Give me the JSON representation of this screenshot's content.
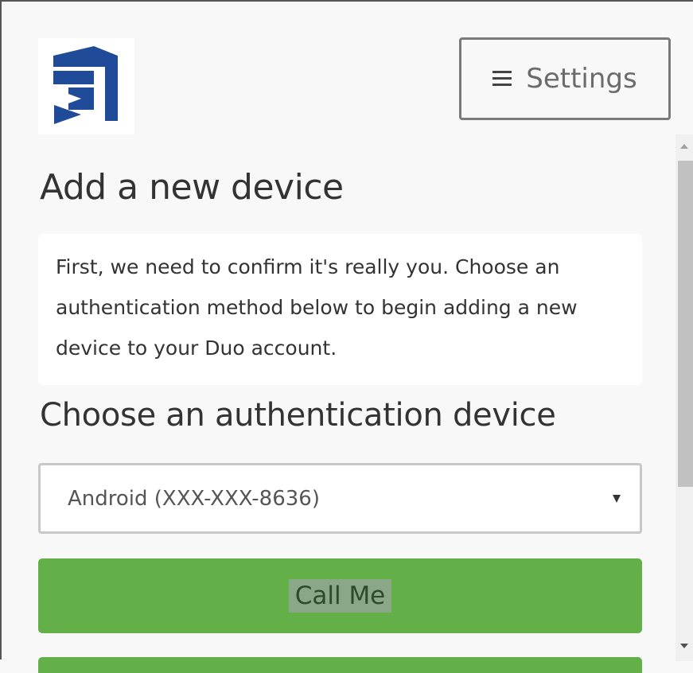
{
  "header": {
    "logo_name": "company-logo",
    "settings_label": "Settings"
  },
  "main": {
    "title": "Add a new device",
    "intro_text": "First, we need to confirm it's really you. Choose an authentication method below to begin adding a new device to your Duo account.",
    "device_heading": "Choose an authentication device",
    "device_select": {
      "selected": "Android (XXX-XXX-8636)"
    },
    "call_me_label": "Call Me"
  },
  "colors": {
    "brand_blue": "#1f4b99",
    "button_green": "#63b048"
  },
  "icons": {
    "settings": "hamburger-icon",
    "select": "chevron-down-icon"
  }
}
